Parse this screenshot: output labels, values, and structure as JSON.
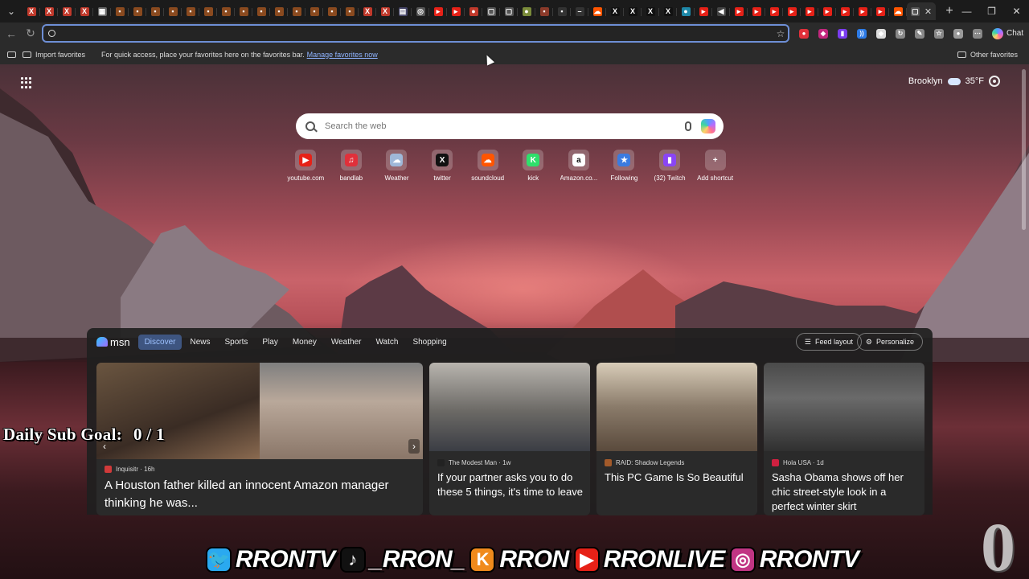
{
  "browser": {
    "tabs": [
      {
        "icon": "x-icon",
        "color": "#c0392b",
        "glyph": "X"
      },
      {
        "icon": "x-icon",
        "color": "#c0392b",
        "glyph": "X"
      },
      {
        "icon": "x-icon",
        "color": "#c0392b",
        "glyph": "X"
      },
      {
        "icon": "x-icon",
        "color": "#c0392b",
        "glyph": "X"
      },
      {
        "icon": "grid-icon",
        "color": "#666666",
        "glyph": "▦"
      },
      {
        "icon": "red-brown-icon",
        "color": "#8a4a1f",
        "glyph": "▪"
      },
      {
        "icon": "red-brown-icon",
        "color": "#8a4a1f",
        "glyph": "▪"
      },
      {
        "icon": "red-brown-icon",
        "color": "#8a4a1f",
        "glyph": "▪"
      },
      {
        "icon": "red-brown-icon",
        "color": "#8a4a1f",
        "glyph": "▪"
      },
      {
        "icon": "red-brown-icon",
        "color": "#8a4a1f",
        "glyph": "▪"
      },
      {
        "icon": "red-brown-icon",
        "color": "#8a4a1f",
        "glyph": "▪"
      },
      {
        "icon": "red-brown-icon",
        "color": "#8a4a1f",
        "glyph": "▪"
      },
      {
        "icon": "red-brown-icon",
        "color": "#8a4a1f",
        "glyph": "▪"
      },
      {
        "icon": "red-brown-icon",
        "color": "#8a4a1f",
        "glyph": "▪"
      },
      {
        "icon": "red-brown-icon",
        "color": "#8a4a1f",
        "glyph": "▪"
      },
      {
        "icon": "red-brown-icon",
        "color": "#8a4a1f",
        "glyph": "▪"
      },
      {
        "icon": "red-brown-icon",
        "color": "#8a4a1f",
        "glyph": "▪"
      },
      {
        "icon": "red-brown-icon",
        "color": "#8a4a1f",
        "glyph": "▪"
      },
      {
        "icon": "red-brown-icon",
        "color": "#8a4a1f",
        "glyph": "▪"
      },
      {
        "icon": "x-icon",
        "color": "#c0392b",
        "glyph": "X"
      },
      {
        "icon": "x-icon",
        "color": "#c0392b",
        "glyph": "X"
      },
      {
        "icon": "gallery-icon",
        "color": "#444466",
        "glyph": "▤"
      },
      {
        "icon": "circle-icon",
        "color": "#555555",
        "glyph": "◎"
      },
      {
        "icon": "youtube-icon",
        "color": "#e62117",
        "glyph": "▸"
      },
      {
        "icon": "youtube-icon",
        "color": "#e62117",
        "glyph": "▸"
      },
      {
        "icon": "bandlab-icon",
        "color": "#c0392b",
        "glyph": "●"
      },
      {
        "icon": "page-icon",
        "color": "#555555",
        "glyph": "▢"
      },
      {
        "icon": "page-icon",
        "color": "#555555",
        "glyph": "▢"
      },
      {
        "icon": "leaf-icon",
        "color": "#7a8b3a",
        "glyph": "●"
      },
      {
        "icon": "game-icon",
        "color": "#8a3a2a",
        "glyph": "▪"
      },
      {
        "icon": "dark-icon",
        "color": "#333333",
        "glyph": "▪"
      },
      {
        "icon": "dark-icon",
        "color": "#333333",
        "glyph": "–"
      },
      {
        "icon": "soundcloud-icon",
        "color": "#ff5500",
        "glyph": "☁"
      },
      {
        "icon": "x-logo-icon",
        "color": "#111111",
        "glyph": "X"
      },
      {
        "icon": "x-logo-icon",
        "color": "#111111",
        "glyph": "X"
      },
      {
        "icon": "x-logo-icon",
        "color": "#111111",
        "glyph": "X"
      },
      {
        "icon": "x-logo-icon",
        "color": "#111111",
        "glyph": "X"
      },
      {
        "icon": "teal-icon",
        "color": "#1e88a8",
        "glyph": "●"
      },
      {
        "icon": "youtube-icon",
        "color": "#e62117",
        "glyph": "▸"
      },
      {
        "icon": "speaker-icon",
        "color": "#444444",
        "glyph": "◀"
      },
      {
        "icon": "youtube-icon",
        "color": "#e62117",
        "glyph": "▸"
      },
      {
        "icon": "youtube-icon",
        "color": "#e62117",
        "glyph": "▸"
      },
      {
        "icon": "youtube-icon",
        "color": "#e62117",
        "glyph": "▸"
      },
      {
        "icon": "youtube-icon",
        "color": "#e62117",
        "glyph": "▸"
      },
      {
        "icon": "youtube-icon",
        "color": "#e62117",
        "glyph": "▸"
      },
      {
        "icon": "youtube-icon",
        "color": "#e62117",
        "glyph": "▸"
      },
      {
        "icon": "youtube-icon",
        "color": "#e62117",
        "glyph": "▸"
      },
      {
        "icon": "youtube-icon",
        "color": "#e62117",
        "glyph": "▸"
      },
      {
        "icon": "youtube-icon",
        "color": "#e62117",
        "glyph": "▸"
      },
      {
        "icon": "soundcloud-icon",
        "color": "#ff5500",
        "glyph": "☁"
      },
      {
        "icon": "newtab-icon",
        "color": "#555555",
        "glyph": "▢"
      }
    ],
    "active_tab_close": "✕",
    "new_tab": "+",
    "window": {
      "minimize": "—",
      "restore": "❐",
      "close": "✕"
    }
  },
  "toolbar": {
    "back": "←",
    "reload": "↻",
    "address_value": "",
    "extensions": [
      {
        "icon": "red-drop-icon",
        "color": "#e0303a",
        "glyph": "●"
      },
      {
        "icon": "pink-icon",
        "color": "#c2277d",
        "glyph": "◆"
      },
      {
        "icon": "twitch-ext-icon",
        "color": "#7a3cf0",
        "glyph": "▮"
      },
      {
        "icon": "wave-icon",
        "color": "#2d7be6",
        "glyph": "))"
      },
      {
        "icon": "diamond-icon",
        "color": "#dddddd",
        "glyph": "◆"
      },
      {
        "icon": "refresh-ext-icon",
        "color": "#888888",
        "glyph": "↻"
      },
      {
        "icon": "brush-icon",
        "color": "#888888",
        "glyph": "✎"
      },
      {
        "icon": "favorites-icon",
        "color": "#888888",
        "glyph": "☆"
      },
      {
        "icon": "profile-icon",
        "color": "#9a9a9a",
        "glyph": "●"
      },
      {
        "icon": "more-icon",
        "color": "#888888",
        "glyph": "⋯"
      }
    ],
    "chat_label": "Chat"
  },
  "favorites_bar": {
    "import_label": "Import favorites",
    "hint": "For quick access, place your favorites here on the favorites bar.",
    "manage_link": "Manage favorites now",
    "other_label": "Other favorites"
  },
  "ntp": {
    "weather": {
      "city": "Brooklyn",
      "temp": "35°F"
    },
    "search_placeholder": "Search the web",
    "shortcuts": [
      {
        "label": "youtube.com",
        "icon": "youtube-icon",
        "color": "#e62117",
        "glyph": "▶"
      },
      {
        "label": "bandlab",
        "icon": "bandlab-icon",
        "color": "#e0303a",
        "glyph": "♫"
      },
      {
        "label": "Weather",
        "icon": "weather-icon",
        "color": "#9fb8d8",
        "glyph": "☁"
      },
      {
        "label": "twitter",
        "icon": "x-logo-icon",
        "color": "#111111",
        "glyph": "X"
      },
      {
        "label": "soundcloud",
        "icon": "soundcloud-icon",
        "color": "#ff5500",
        "glyph": "☁"
      },
      {
        "label": "kick",
        "icon": "kick-icon",
        "color": "#2ee06b",
        "glyph": "K"
      },
      {
        "label": "Amazon.co...",
        "icon": "amazon-icon",
        "color": "#ffffff",
        "glyph": "a"
      },
      {
        "label": "Following",
        "icon": "star-people-icon",
        "color": "#3a7be0",
        "glyph": "★"
      },
      {
        "label": "(32) Twitch",
        "icon": "twitch-icon",
        "color": "#8a45f5",
        "glyph": "▮"
      },
      {
        "label": "Add shortcut",
        "icon": "plus-icon",
        "color": "transparent",
        "glyph": "+"
      }
    ]
  },
  "feed": {
    "logo": "msn",
    "tabs": [
      "Discover",
      "News",
      "Sports",
      "Play",
      "Money",
      "Weather",
      "Watch",
      "Shopping"
    ],
    "feed_layout_label": "Feed layout",
    "personalize_label": "Personalize",
    "cards": [
      {
        "source": "Inquisitr · 16h",
        "source_color": "#d03a3a",
        "title": "A Houston father killed an innocent Amazon manager thinking he was..."
      },
      {
        "source": "The Modest Man · 1w",
        "source_color": "#222222",
        "title": "If your partner asks you to do these 5 things, it's time to leave"
      },
      {
        "source": "RAID: Shadow Legends",
        "source_color": "#a35a2a",
        "title": "This PC Game Is So Beautiful"
      },
      {
        "source": "Hola USA · 1d",
        "source_color": "#d02040",
        "title": "Sasha Obama shows off her chic street-style look in a perfect winter skirt"
      }
    ]
  },
  "overlay": {
    "sub_goal_label": "Daily Sub Goal:",
    "sub_goal_count": "0 / 1",
    "socials": [
      {
        "icon": "twitter-bird-icon",
        "color": "#2aa9f0",
        "glyph": "🐦",
        "handle": "RRONTV"
      },
      {
        "icon": "tiktok-icon",
        "color": "#111111",
        "glyph": "♪",
        "handle": "_RRON_"
      },
      {
        "icon": "kick-icon",
        "color": "#f08a1c",
        "glyph": "K",
        "handle": "RRON"
      },
      {
        "icon": "youtube-icon",
        "color": "#e62117",
        "glyph": "▶",
        "handle": "RRONLIVE"
      },
      {
        "icon": "instagram-icon",
        "color": "#c13584",
        "glyph": "◎",
        "handle": "RRONTV"
      }
    ],
    "corner_number": "0"
  }
}
